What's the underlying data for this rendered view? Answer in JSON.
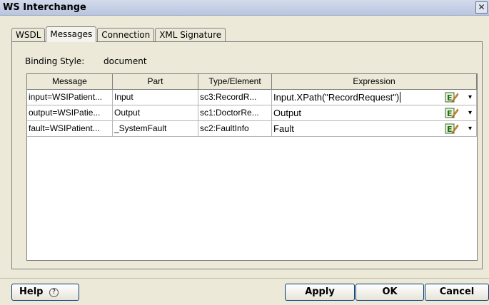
{
  "window": {
    "title": "WS Interchange",
    "close_glyph": "✕"
  },
  "tabs": [
    {
      "label": "WSDL",
      "active": false
    },
    {
      "label": "Messages",
      "active": true
    },
    {
      "label": "Connection",
      "active": false
    },
    {
      "label": "XML Signature",
      "active": false
    }
  ],
  "binding": {
    "label": "Binding Style:",
    "value": "document"
  },
  "grid": {
    "headers": {
      "message": "Message",
      "part": "Part",
      "type": "Type/Element",
      "expression": "Expression"
    },
    "rows": [
      {
        "message": "input=WSIPatient...",
        "part": "Input",
        "type": "sc3:RecordR...",
        "expression": "Input.XPath(\"RecordRequest\")"
      },
      {
        "message": "output=WSIPatie...",
        "part": "Output",
        "type": "sc1:DoctorRe...",
        "expression": "Output"
      },
      {
        "message": "fault=WSIPatient...",
        "part": "_SystemFault",
        "type": "sc2:FaultInfo",
        "expression": "Fault"
      }
    ],
    "expr_button_icon": "expression-editor-icon",
    "dropdown_glyph": "▾"
  },
  "buttons": {
    "help": "Help",
    "help_glyph": "?",
    "apply": "Apply",
    "ok": "OK",
    "cancel": "Cancel"
  }
}
